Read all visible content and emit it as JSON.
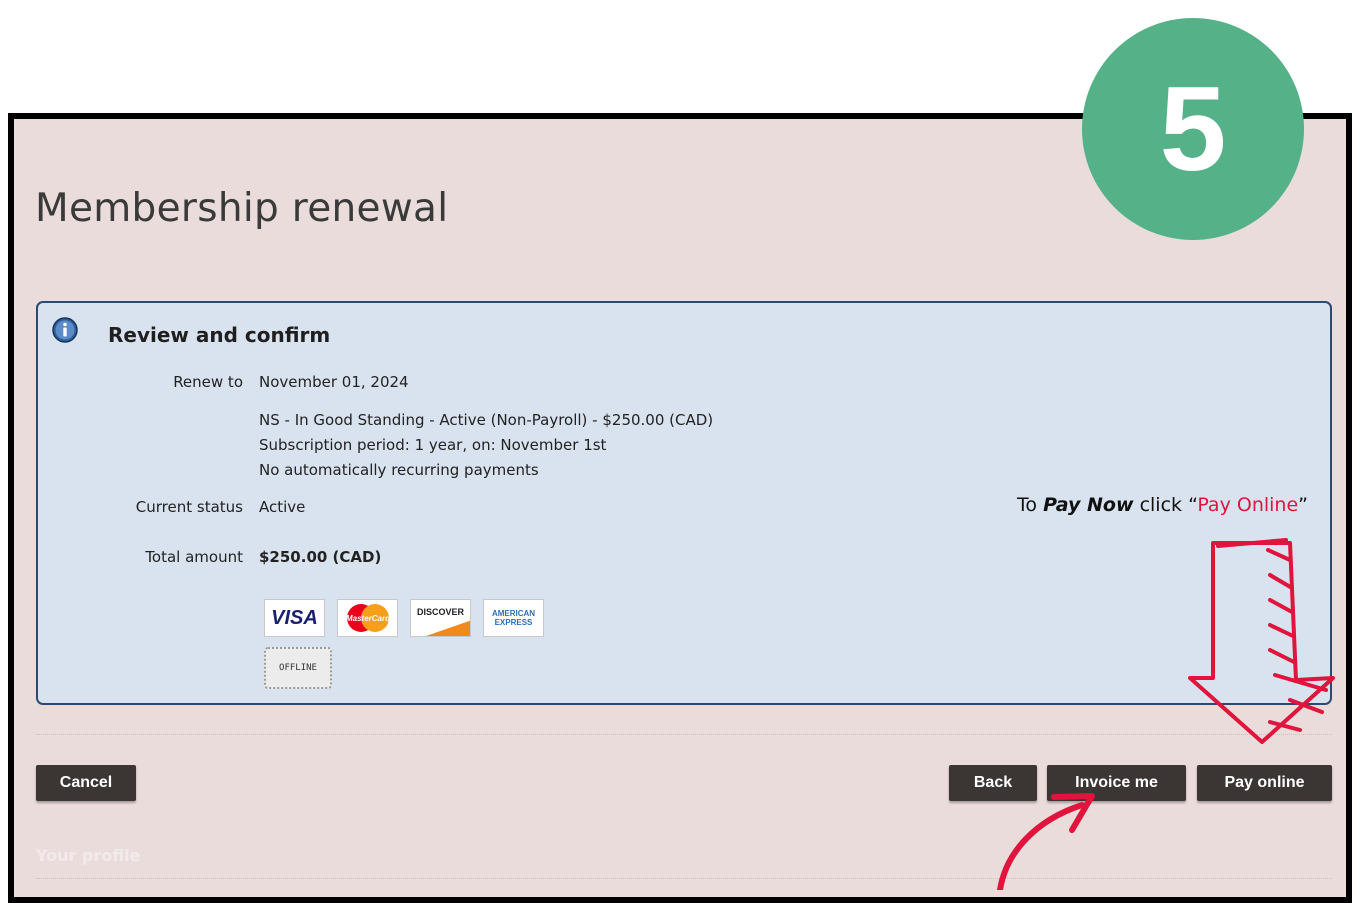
{
  "step": {
    "number": "5",
    "color": "#55b187"
  },
  "page": {
    "title": "Membership renewal"
  },
  "panel": {
    "heading": "Review and confirm",
    "icon": "info-icon",
    "fields": {
      "renew_to_label": "Renew to",
      "renew_to_value": "November 01, 2024",
      "plan_line1": "NS - In Good Standing - Active (Non-Payroll) - $250.00 (CAD)",
      "plan_line2": "Subscription period: 1 year, on: November 1st",
      "plan_line3": "No automatically recurring payments",
      "status_label": "Current status",
      "status_value": "Active",
      "total_label": "Total amount",
      "total_value": "$250.00 (CAD)"
    },
    "payment_methods": {
      "visa": "VISA",
      "mastercard": "MasterCard",
      "discover": "DISCOVER",
      "amex_line1": "AMERICAN",
      "amex_line2": "EXPRESS",
      "offline": "OFFLINE"
    }
  },
  "annotation": {
    "prefix": "To ",
    "emphasis": "Pay Now",
    "middle": " click “",
    "highlight": "Pay Online",
    "suffix": "”",
    "accent_color": "#e0143c"
  },
  "buttons": {
    "cancel": "Cancel",
    "back": "Back",
    "invoice": "Invoice me",
    "pay": "Pay online"
  },
  "footer": {
    "profile": "Your profile"
  }
}
